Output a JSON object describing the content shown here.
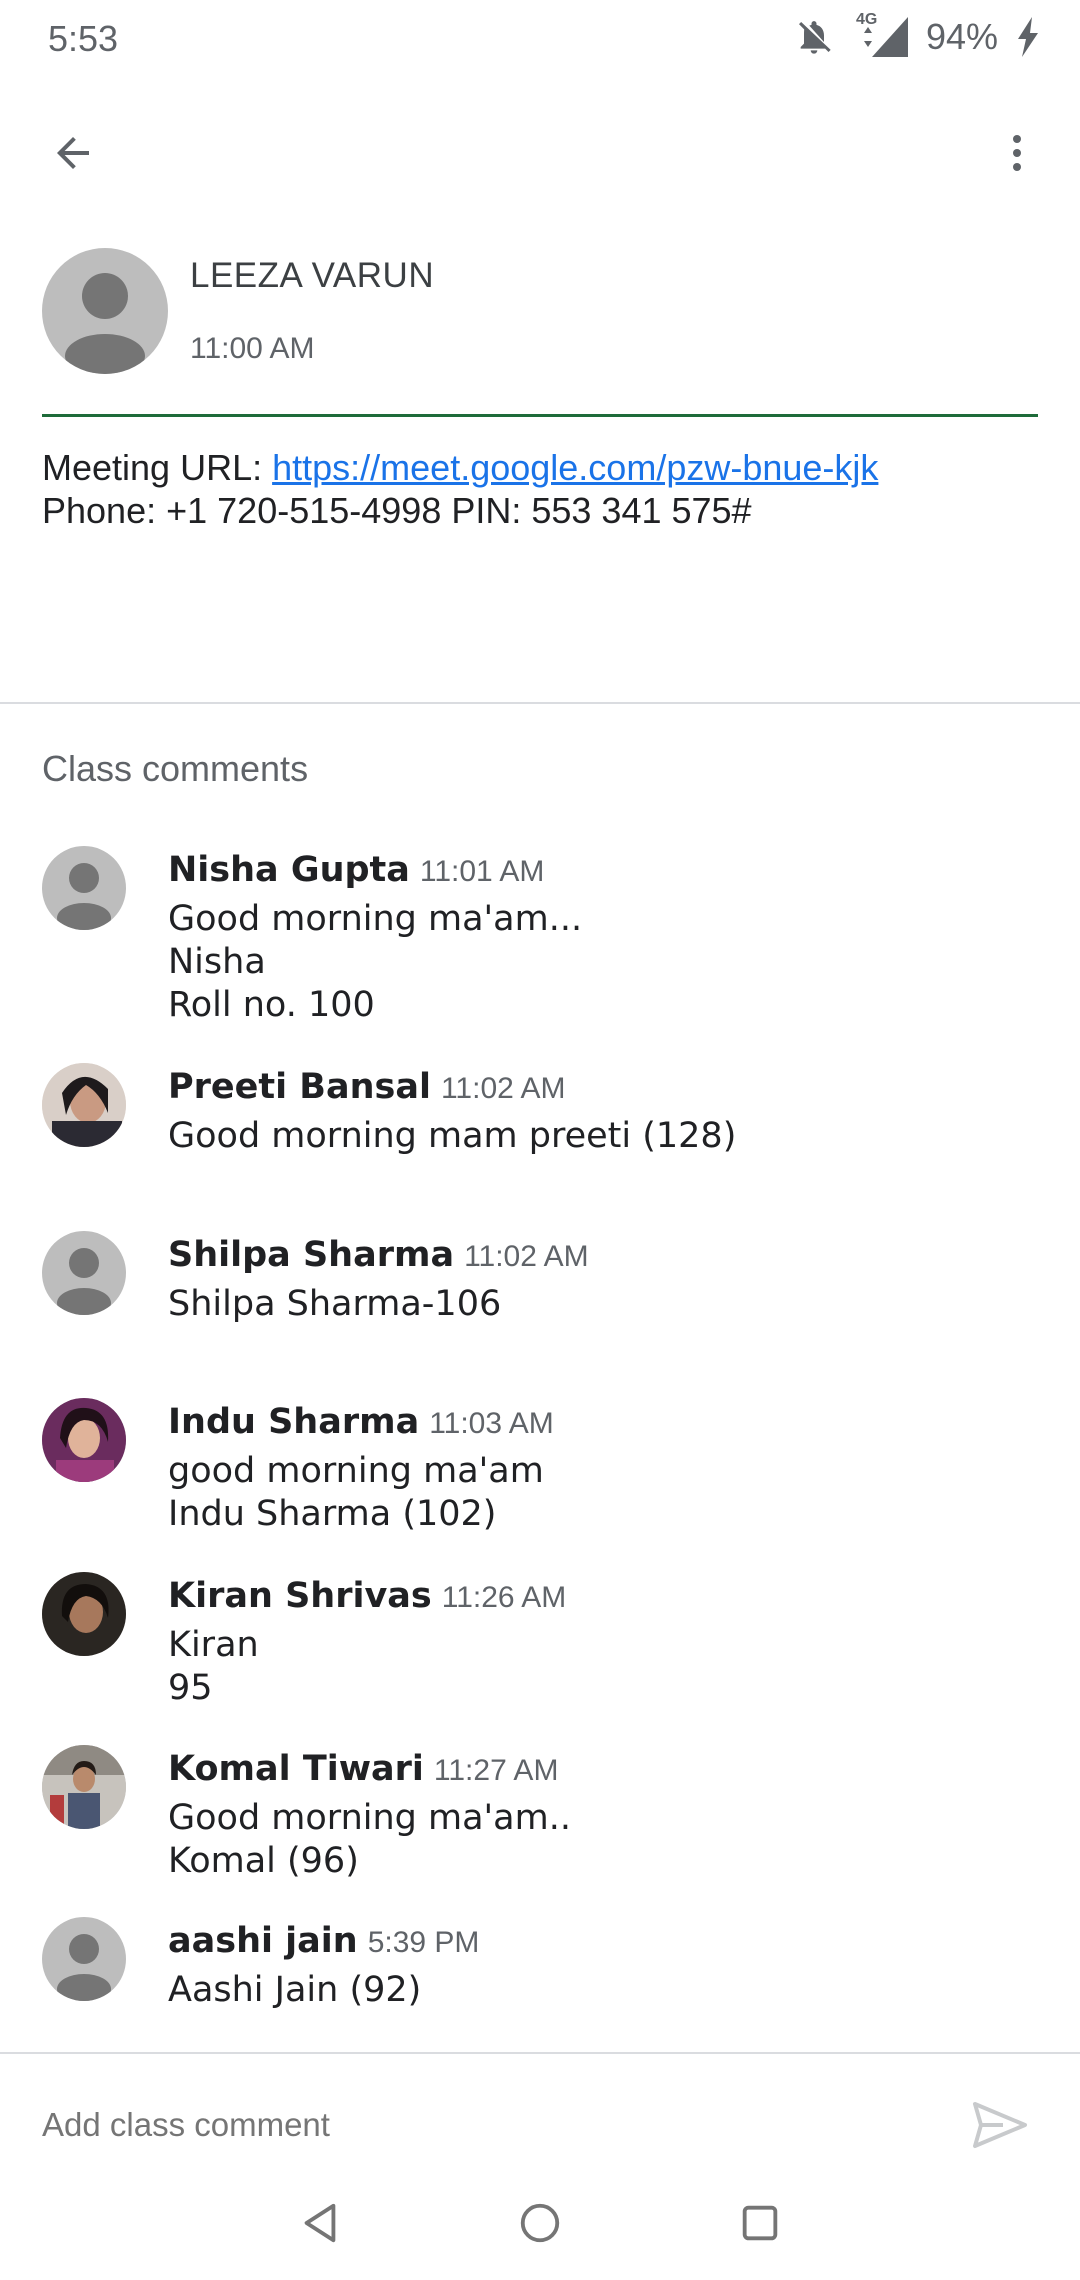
{
  "status_bar": {
    "time": "5:53",
    "network": "4G",
    "battery": "94%"
  },
  "icons": {
    "back": "arrow-back-icon",
    "more": "more-vert-icon",
    "send": "send-icon",
    "silent": "bell-off-icon",
    "signal": "signal-icon",
    "battery": "charging-icon"
  },
  "post": {
    "author": "LEEZA VARUN",
    "time": "11:00 AM",
    "body_label": "Meeting URL: ",
    "url": "https://meet.google.com/pzw-bnue-kjk",
    "phone_line": "Phone: +1 720-515-4998 PIN: 553 341 575#"
  },
  "comments_section": {
    "title": "Class comments",
    "items": [
      {
        "name": "Nisha Gupta",
        "time": "11:01 AM",
        "text": "Good morning ma'am...\nNisha\nRoll no. 100",
        "avatar": "default"
      },
      {
        "name": "Preeti Bansal",
        "time": "11:02 AM",
        "text": "Good morning mam preeti (128)",
        "avatar": "photo"
      },
      {
        "name": "Shilpa Sharma",
        "time": "11:02 AM",
        "text": "Shilpa Sharma-106",
        "avatar": "default"
      },
      {
        "name": "Indu Sharma",
        "time": "11:03 AM",
        "text": "good morning ma'am\nIndu Sharma (102)",
        "avatar": "photo"
      },
      {
        "name": "Kiran Shrivas",
        "time": "11:26 AM",
        "text": "Kiran\n95",
        "avatar": "photo"
      },
      {
        "name": "Komal Tiwari",
        "time": "11:27 AM",
        "text": "Good morning ma'am..\nKomal (96)",
        "avatar": "photo"
      },
      {
        "name": "aashi jain",
        "time": "5:39 PM",
        "text": "Aashi Jain (92)",
        "avatar": "default"
      }
    ]
  },
  "composer": {
    "placeholder": "Add class comment"
  },
  "colors": {
    "accent_rule": "#1e6b3a",
    "link": "#1a73e8",
    "avatar_default": "#bdbdbd"
  }
}
